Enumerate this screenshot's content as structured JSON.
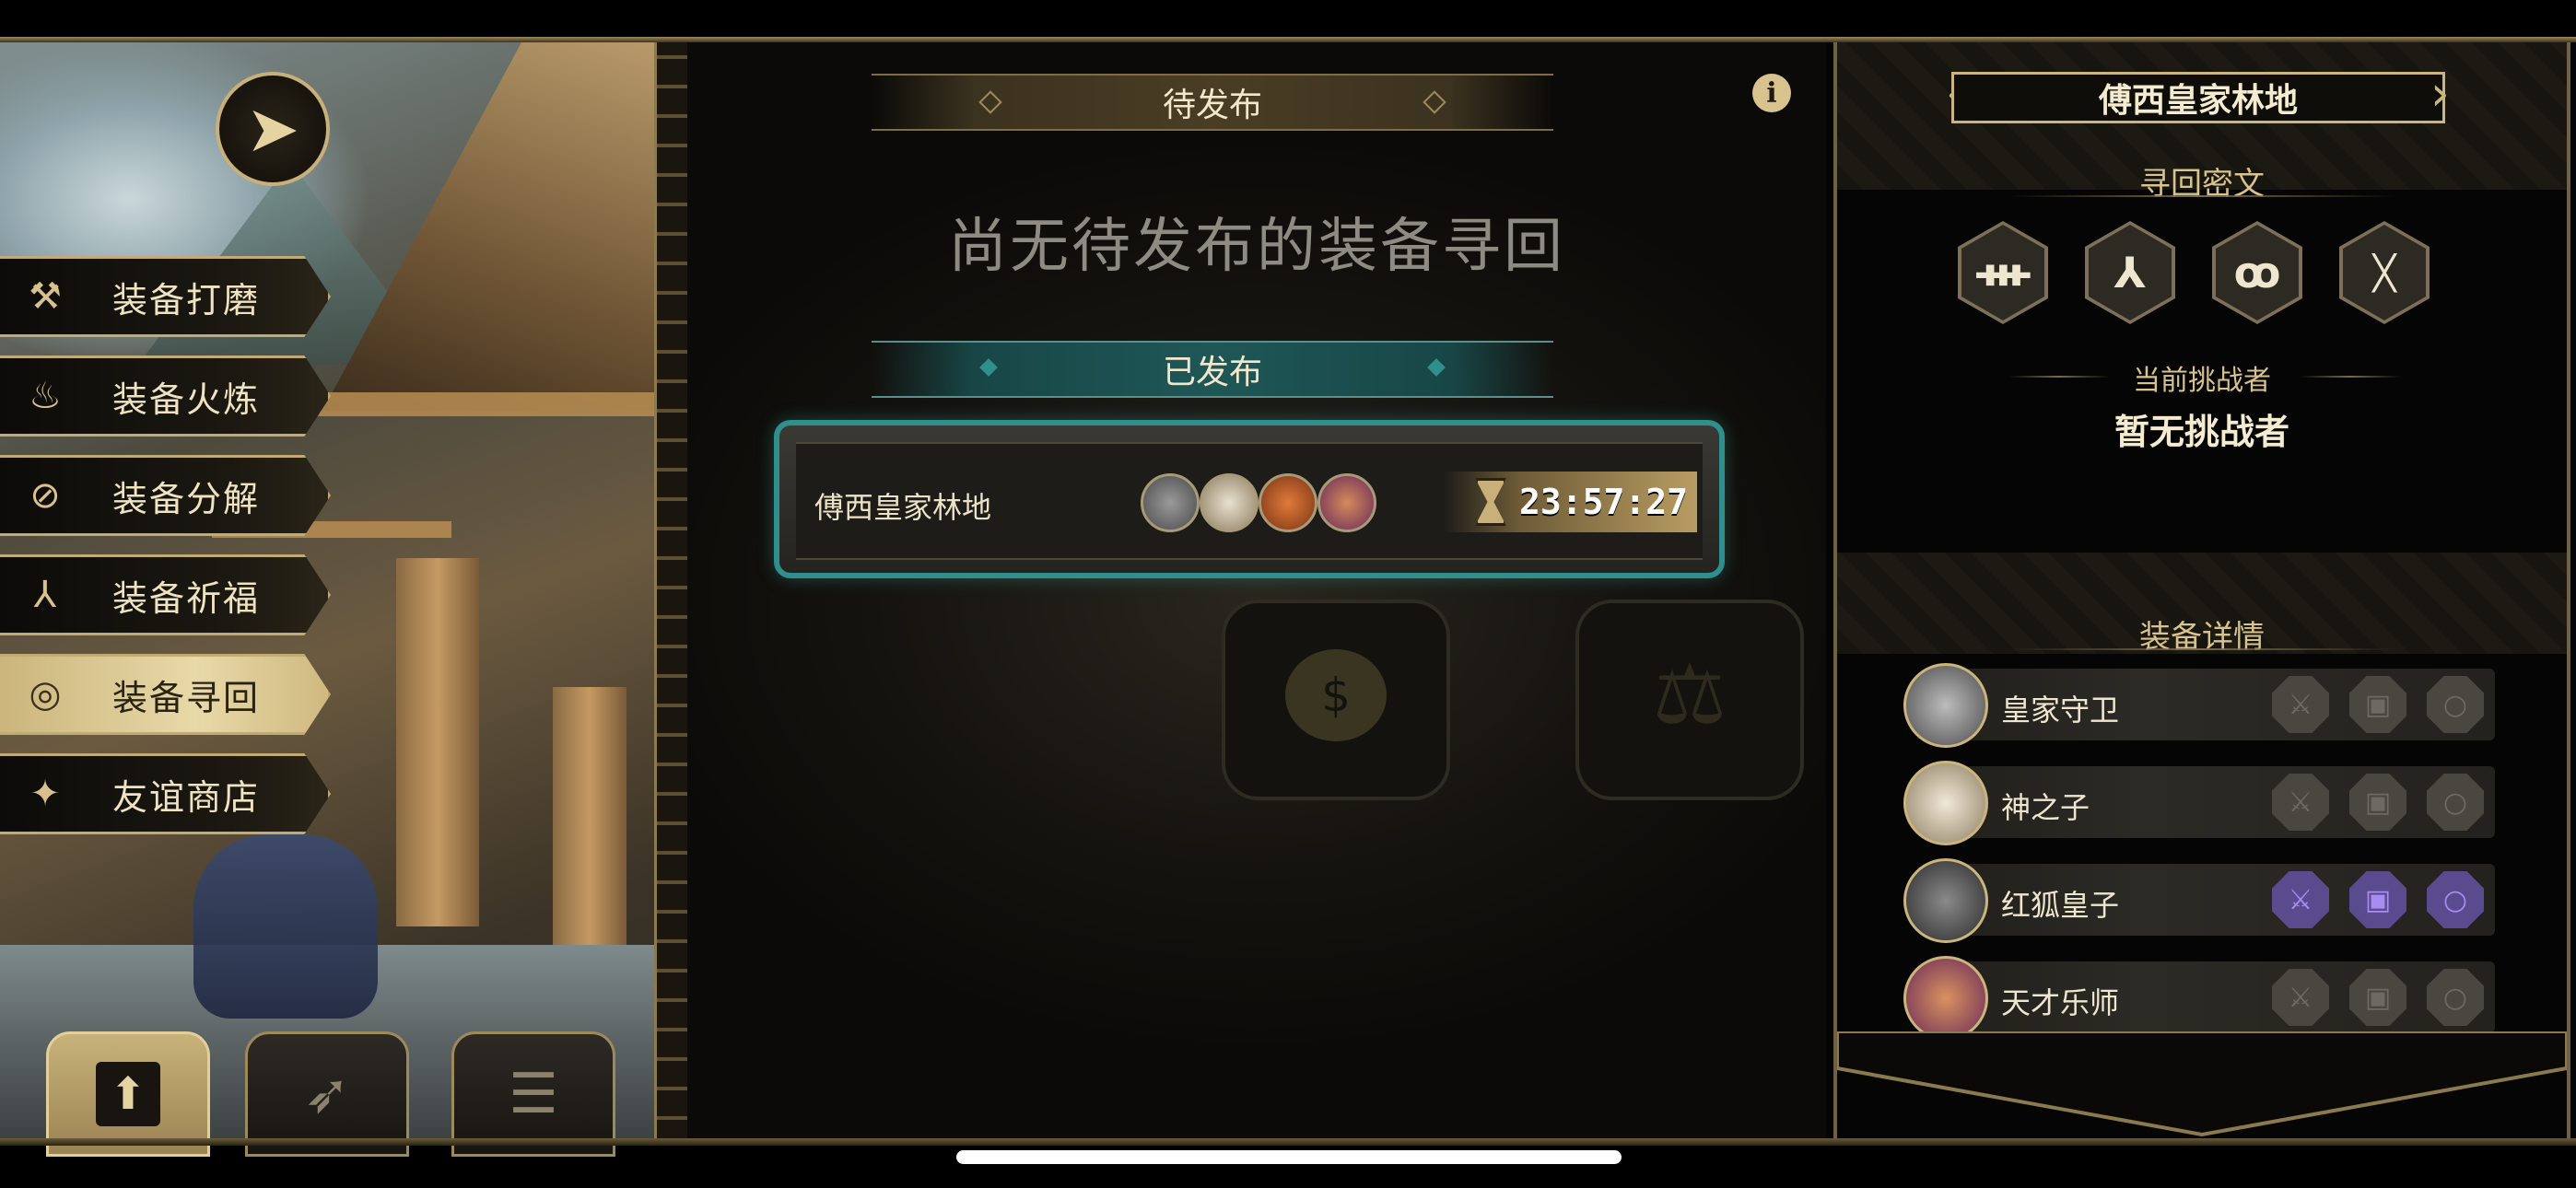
{
  "left_menu": {
    "items": [
      {
        "label": "装备打磨",
        "icon": "hammer-icon",
        "active": false
      },
      {
        "label": "装备火炼",
        "icon": "flame-icon",
        "active": false
      },
      {
        "label": "装备分解",
        "icon": "disassemble-icon",
        "active": false
      },
      {
        "label": "装备祈福",
        "icon": "pray-icon",
        "active": false
      },
      {
        "label": "装备寻回",
        "icon": "target-icon",
        "active": true
      },
      {
        "label": "友谊商店",
        "icon": "fox-icon",
        "active": false
      }
    ]
  },
  "bottom_tabs": [
    {
      "icon": "upload-icon",
      "active": true
    },
    {
      "icon": "feather-icon",
      "active": false
    },
    {
      "icon": "list-icon",
      "active": false
    }
  ],
  "center": {
    "pending_header": "待发布",
    "empty_message": "尚无待发布的装备寻回",
    "published_header": "已发布",
    "published_card": {
      "location": "傅西皇家林地",
      "timer": "23:57:27",
      "party_icons": [
        "guard-avatar",
        "hat-avatar",
        "fox-avatar",
        "musician-avatar"
      ]
    }
  },
  "right_panel": {
    "title": "傅西皇家林地",
    "cipher_label": "寻回密文",
    "cipher_glyphs": [
      "ᚒ",
      "⅄",
      "ꝏ",
      "ᚷ"
    ],
    "challenger_label": "当前挑战者",
    "challenger_value": "暂无挑战者",
    "details_label": "装备详情",
    "characters": [
      {
        "name": "皇家守卫",
        "avatar": "guard-avatar",
        "slots_lit": false
      },
      {
        "name": "神之子",
        "avatar": "hat-avatar",
        "slots_lit": false
      },
      {
        "name": "红狐皇子",
        "avatar": "wolf-avatar",
        "slots_lit": true
      },
      {
        "name": "天才乐师",
        "avatar": "musician-avatar",
        "slots_lit": false
      }
    ]
  },
  "colors": {
    "gold": "#cbb57c",
    "teal": "#2f8f8c",
    "purple": "#5a4b8f"
  }
}
